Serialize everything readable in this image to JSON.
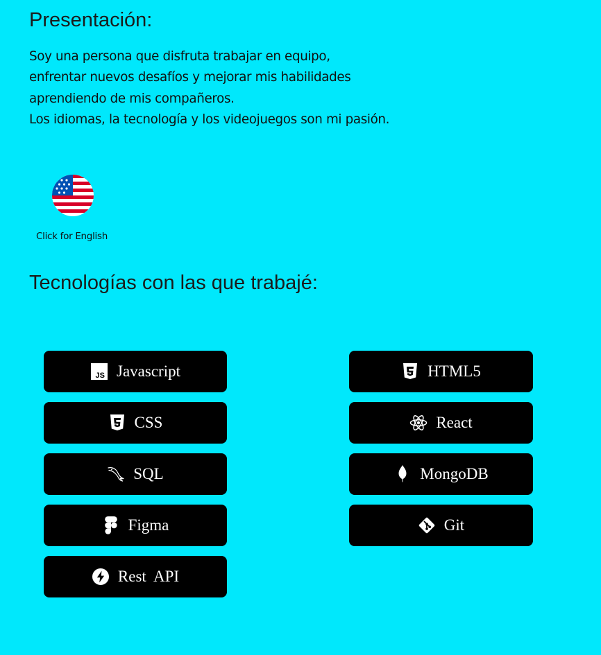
{
  "presentation": {
    "title": "Presentación:",
    "lines": [
      "Soy una persona que disfruta trabajar en equipo,",
      "enfrentar nuevos desafíos y mejorar mis habilidades",
      "aprendiendo de mis compañeros.",
      "Los idiomas, la tecnología y los videojuegos son mi pasión."
    ]
  },
  "language_switch": {
    "label": "Click for English",
    "icon": "us-flag-icon"
  },
  "technologies": {
    "title": "Tecnologías con las que trabajé:",
    "items": [
      {
        "label": "Javascript",
        "icon": "javascript-icon"
      },
      {
        "label": "HTML5",
        "icon": "html5-icon"
      },
      {
        "label": "CSS",
        "icon": "css3-icon"
      },
      {
        "label": "React",
        "icon": "react-icon"
      },
      {
        "label": "SQL",
        "icon": "mysql-dolphin-icon"
      },
      {
        "label": "MongoDB",
        "icon": "mongodb-leaf-icon"
      },
      {
        "label": "Figma",
        "icon": "figma-icon"
      },
      {
        "label": "Git",
        "icon": "git-icon"
      },
      {
        "label": "Rest  API",
        "icon": "lightning-bolt-icon"
      }
    ]
  },
  "colors": {
    "background": "#00e8fc",
    "button_background": "#000000",
    "button_text": "#ffffff"
  }
}
